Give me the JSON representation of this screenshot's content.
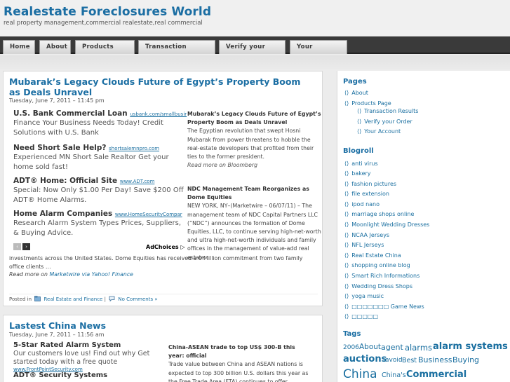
{
  "site": {
    "title": "Realestate Foreclosures World",
    "description": "real property management,commercial realestate,real commercial"
  },
  "nav": [
    "Home",
    "About",
    "Products Page",
    "Transaction Results",
    "Verify your Order",
    "Your Account"
  ],
  "post1": {
    "title": "Mubarak’s Legacy Clouds Future of Egypt’s Property Boom as Deals Unravel",
    "date": "Tuesday, June 7, 2011 – 11:45 pm",
    "ads": [
      {
        "head": "U.S. Bank Commercial Loan",
        "url": "usbank.com/smallbusir",
        "body": "Finance Your Business Needs Today! Credit Solutions with U.S. Bank"
      },
      {
        "head": "Need Short Sale Help?",
        "url": "shortsalemnpro.com",
        "body": "Experienced MN Short Sale Realtor Get your home sold fast!"
      },
      {
        "head": "ADT® Home: Official Site",
        "url": "www.ADT.com",
        "body": "Special: Now Only $1.00 Per Day! Save $200 Off ADT® Home Alarms."
      },
      {
        "head": "Home Alarm Companies",
        "url": "www.HomeSecurityCompar",
        "body": "Research Alarm System Types Prices, Suppliers, & Buying Advice."
      }
    ],
    "ad_prev": "‹",
    "ad_next": "›",
    "adchoices": "AdChoices ▷",
    "news": [
      {
        "title": "Mubarak’s Legacy Clouds Future of Egypt’s Property Boom as Deals Unravel",
        "body": "The Egyptian revolution that swept Hosni Mubarak from power threatens to hobble the real-estate developers that profited from their ties to the former president.",
        "read_more": "Read more on",
        "source": "Bloomberg"
      },
      {
        "title": "NDC Management Team Reorganizes as Dome Equities",
        "body": "NEW YORK, NY–(Marketwire – 06/07/11) – The management team of NDC Capital Partners LLC (“NDC”) announces the formation of Dome Equities, LLC, to continue serving high-net-worth and ultra high-net-worth individuals and family offices in the management of value-add real estate"
      }
    ],
    "continued": "investments across the United States. Dome Equities has received a 0 Million commitment from two family office clients …",
    "read_more2": "Read more on",
    "source2": "Marketwire via Yahoo! Finance",
    "posted_in": "Posted in",
    "category": "Real Estate and Finance",
    "separator": "|",
    "comments": "No Comments »"
  },
  "post2": {
    "title": "Lastest China News",
    "date": "Tuesday, June 7, 2011 – 11:56 am",
    "ads": [
      {
        "head": "5-Star Rated Alarm System",
        "body": "Our customers love us! Find out why Get started today with a free quote",
        "url": "www.FrontPointSecurity.com"
      },
      {
        "head": "ADT® Security Systems",
        "body": ""
      }
    ],
    "news_title": "China-ASEAN trade to top US$ 300-B this year: official",
    "news_body": "Trade value between China and ASEAN nations is expected to top 300 billion U.S. dollars this year as the Free Trade Area (FTA) continues to offer"
  },
  "sidebar": {
    "pages_title": "Pages",
    "pages": [
      {
        "label": "About",
        "sub": false
      },
      {
        "label": "Products Page",
        "sub": false
      },
      {
        "label": "Transaction Results",
        "sub": true
      },
      {
        "label": "Verify your Order",
        "sub": true
      },
      {
        "label": "Your Account",
        "sub": true
      }
    ],
    "blogroll_title": "Blogroll",
    "blogroll": [
      "anti virus",
      "bakery",
      "fashion pictures",
      "file extension",
      "ipod nano",
      "marriage shops online",
      "Moonlight Wedding Dresses",
      "NCAA Jerseys",
      "NFL Jerseys",
      "Real Estate China",
      "shopping online blog",
      "Smart Rich Informations",
      "Wedding Dress Shops",
      "yoga music",
      "□□□□□□□ Game News",
      "□□□□□"
    ],
    "tags_title": "Tags",
    "tags_row1": [
      "2006",
      "About",
      "agent",
      "alarms",
      "alarm systems"
    ],
    "tags_row2": [
      "auctions",
      "avoid",
      "Best",
      "Business",
      "Buying"
    ],
    "tags_row3": [
      "China",
      "China's",
      "Commercial"
    ]
  },
  "colors": {
    "accent": "#1b6ea3",
    "navbar": "#3a3a3a"
  }
}
